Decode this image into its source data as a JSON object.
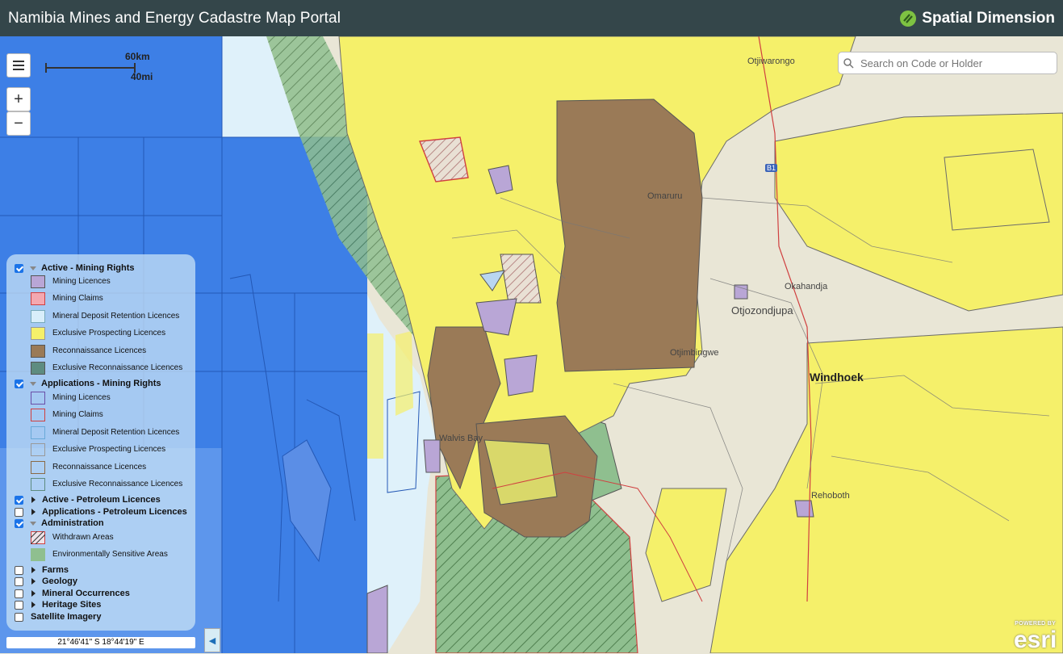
{
  "header": {
    "title": "Namibia Mines and Energy Cadastre Map Portal",
    "brand": "Spatial Dimension"
  },
  "controls": {
    "menu_icon": "hamburger-icon",
    "zoom_in": "+",
    "zoom_out": "−"
  },
  "scalebar": {
    "top": "60km",
    "bottom": "40mi"
  },
  "search": {
    "placeholder": "Search on Code or Holder",
    "icon": "search-icon"
  },
  "legend": {
    "groups": [
      {
        "label": "Active - Mining Rights",
        "checked": true,
        "expanded": true,
        "items": [
          "Mining Licences",
          "Mining Claims",
          "Mineral Deposit Retention Licences",
          "Exclusive Prospecting Licences",
          "Reconnaissance Licences",
          "Exclusive Reconnaissance Licences"
        ]
      },
      {
        "label": "Applications - Mining Rights",
        "checked": true,
        "expanded": true,
        "items": [
          "Mining Licences",
          "Mining Claims",
          "Mineral Deposit Retention Licences",
          "Exclusive Prospecting Licences",
          "Reconnaissance Licences",
          "Exclusive Reconnaissance Licences"
        ]
      },
      {
        "label": "Active - Petroleum Licences",
        "checked": true,
        "expanded": false
      },
      {
        "label": "Applications - Petroleum Licences",
        "checked": false,
        "expanded": false
      },
      {
        "label": "Administration",
        "checked": true,
        "expanded": true,
        "items": [
          "Withdrawn Areas",
          "Environmentally Sensitive Areas"
        ]
      },
      {
        "label": "Farms",
        "checked": false,
        "expanded": false
      },
      {
        "label": "Geology",
        "checked": false,
        "expanded": false
      },
      {
        "label": "Mineral Occurrences",
        "checked": false,
        "expanded": false
      },
      {
        "label": "Heritage Sites",
        "checked": false,
        "expanded": false
      },
      {
        "label": "Satellite Imagery",
        "checked": false,
        "expanded": null
      }
    ]
  },
  "coordinates": "21°46'41\" S  18°44'19\" E",
  "collapse_icon": "chevron-left-icon",
  "attribution": {
    "powered_by": "POWERED BY",
    "esri": "esri"
  },
  "map_labels": [
    "Otjiwarongo",
    "Windhoek",
    "Otjozondjupa",
    "Okahandja",
    "Rehoboth",
    "Walvis Bay",
    "Omaruru",
    "Otjimbingwe",
    "B1"
  ],
  "colors": {
    "header": "#34464a",
    "ocean_deep": "#3d7fe6",
    "ocean_light": "#dff1fa",
    "land": "#e9e6d6",
    "epl_yellow": "#f5f06a",
    "recon_brown": "#9a7a57",
    "mining_purple": "#b9a6d6",
    "sensitive_green": "#8fbf8f",
    "withdrawn_red": "#e0454f"
  }
}
